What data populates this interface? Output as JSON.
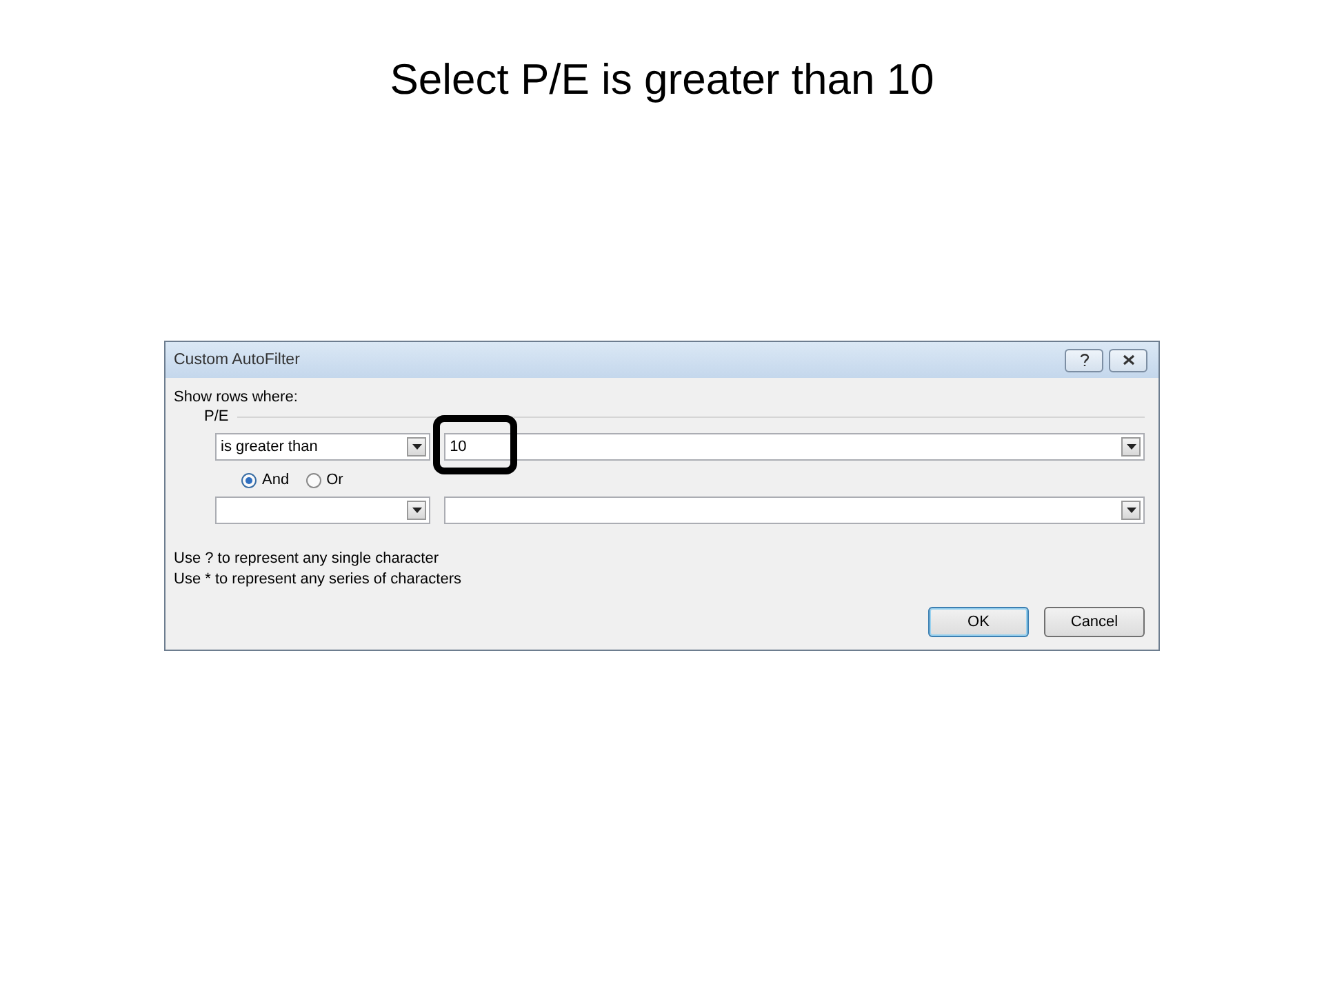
{
  "slide": {
    "title": "Select P/E is greater than 10"
  },
  "dialog": {
    "title": "Custom AutoFilter",
    "prompt": "Show rows where:",
    "field_label": "P/E",
    "criteria": [
      {
        "operator": "is greater than",
        "value": "10",
        "highlighted": true
      },
      {
        "highlighted": false
      }
    ],
    "join": [
      {
        "label": "And",
        "selected": true
      },
      {
        "label": "Or",
        "selected": false
      }
    ],
    "hints": [
      "Use ? to represent any single character",
      "Use * to represent any series of characters"
    ],
    "buttons": [
      {
        "label": "OK",
        "default": true
      },
      {
        "label": "Cancel",
        "default": false
      }
    ]
  }
}
